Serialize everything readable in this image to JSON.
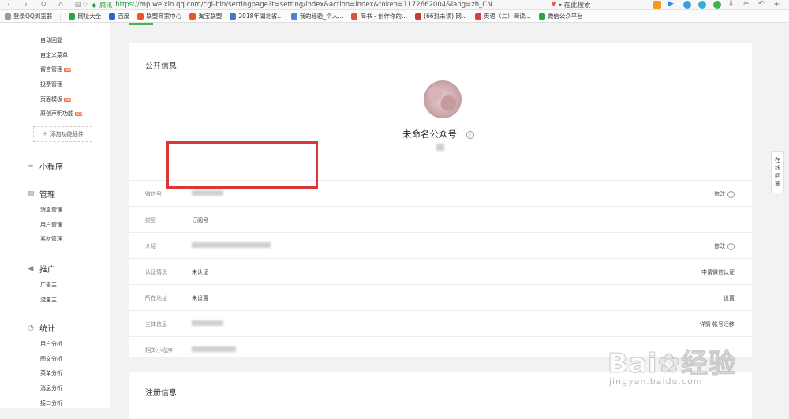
{
  "browser": {
    "brand": "腾讯",
    "url_scheme": "https://",
    "url_rest": "mp.weixin.qq.com/cgi-bin/settingpage?t=setting/index&action=index&token=1172662004&lang=zh_CN",
    "search_label": "在此搜索"
  },
  "bookmarks": [
    {
      "label": "登录QQ浏览器",
      "color": "#999999"
    },
    {
      "label": "网址大全",
      "color": "#2aa745"
    },
    {
      "label": "百度",
      "color": "#3060d8"
    },
    {
      "label": "联盟商家中心",
      "color": "#e8542c"
    },
    {
      "label": "淘宝联盟",
      "color": "#e8542c"
    },
    {
      "label": "2018年湖北省...",
      "color": "#4577c9"
    },
    {
      "label": "我的经验_个人...",
      "color": "#4c7fd6"
    },
    {
      "label": "简书 - 创作你的...",
      "color": "#d9523f"
    },
    {
      "label": "(66封未读) 网...",
      "color": "#c83a35"
    },
    {
      "label": "英语（二）阅读...",
      "color": "#d94141"
    },
    {
      "label": "微信公众平台",
      "color": "#2aa745"
    }
  ],
  "sidebar": {
    "function_items": [
      {
        "label": "自动回复",
        "new": false
      },
      {
        "label": "自定义菜单",
        "new": false
      },
      {
        "label": "留言管理",
        "new": true
      },
      {
        "label": "投票管理",
        "new": false
      },
      {
        "label": "页面模板",
        "new": true
      },
      {
        "label": "原创声明功能",
        "new": true
      }
    ],
    "new_badge": "NEW",
    "add_plugin": "添加功能插件",
    "sections": [
      {
        "title": "小程序",
        "icon": "link-icon",
        "items": []
      },
      {
        "title": "管理",
        "icon": "inbox-icon",
        "items": [
          "消息管理",
          "用户管理",
          "素材管理"
        ]
      },
      {
        "title": "推广",
        "icon": "megaphone-icon",
        "items": [
          "广告主",
          "流量主"
        ]
      },
      {
        "title": "统计",
        "icon": "pie-chart-icon",
        "items": [
          "用户分析",
          "图文分析",
          "菜单分析",
          "消息分析",
          "接口分析"
        ]
      }
    ]
  },
  "public_info": {
    "title": "公开信息",
    "account_name": "未命名公众号",
    "help": "?",
    "rows": [
      {
        "label": "微信号",
        "value": "",
        "blurred": true,
        "action": "修改",
        "help": true
      },
      {
        "label": "类型",
        "value": "订阅号",
        "blurred": false,
        "action": "",
        "help": false
      },
      {
        "label": "介绍",
        "value": "",
        "blurred": true,
        "action": "修改",
        "help": true
      },
      {
        "label": "认证情况",
        "value": "未认证",
        "blurred": false,
        "action": "申请微信认证",
        "help": false
      },
      {
        "label": "所在地址",
        "value": "未设置",
        "blurred": false,
        "action": "设置",
        "help": false
      },
      {
        "label": "主体信息",
        "value": "",
        "blurred": true,
        "action": "详情  帐号迁移",
        "help": false
      },
      {
        "label": "相关小程序",
        "value": "",
        "blurred": true,
        "action": "",
        "help": false
      }
    ]
  },
  "register_info": {
    "title": "注册信息"
  },
  "float_panel": {
    "label": "在线问答"
  },
  "watermark": {
    "main": "Bai",
    "main2": "经验",
    "sub": "jingyan.baidu.com"
  }
}
